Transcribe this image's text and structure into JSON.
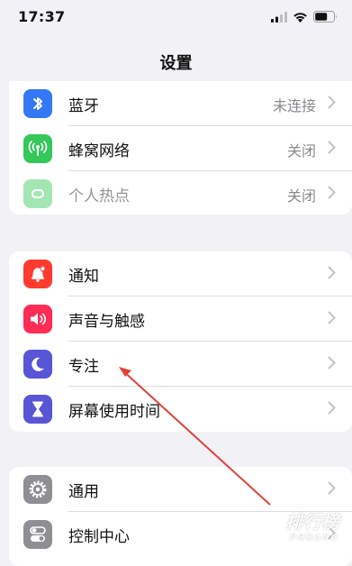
{
  "status_bar": {
    "time": "17:37"
  },
  "nav": {
    "title": "设置"
  },
  "group1": [
    {
      "label": "蓝牙",
      "value": "未连接",
      "icon": "bluetooth-icon",
      "color": "#3478f6"
    },
    {
      "label": "蜂窝网络",
      "value": "关闭",
      "icon": "antenna-icon",
      "color": "#34c759"
    },
    {
      "label": "个人热点",
      "value": "关闭",
      "icon": "hotspot-icon",
      "color": "#34c759",
      "disabled": true
    }
  ],
  "group2": [
    {
      "label": "通知",
      "icon": "bell-icon",
      "color": "#ff3b30"
    },
    {
      "label": "声音与触感",
      "icon": "speaker-icon",
      "color": "#ff2d55"
    },
    {
      "label": "专注",
      "icon": "moon-icon",
      "color": "#5856d6"
    },
    {
      "label": "屏幕使用时间",
      "icon": "hourglass-icon",
      "color": "#5856d6"
    }
  ],
  "group3": [
    {
      "label": "通用",
      "icon": "gear-icon",
      "color": "#8e8e93"
    },
    {
      "label": "控制中心",
      "icon": "toggles-icon",
      "color": "#8e8e93"
    }
  ],
  "watermark": {
    "text": "排行榜",
    "sub": "PHBANG"
  }
}
